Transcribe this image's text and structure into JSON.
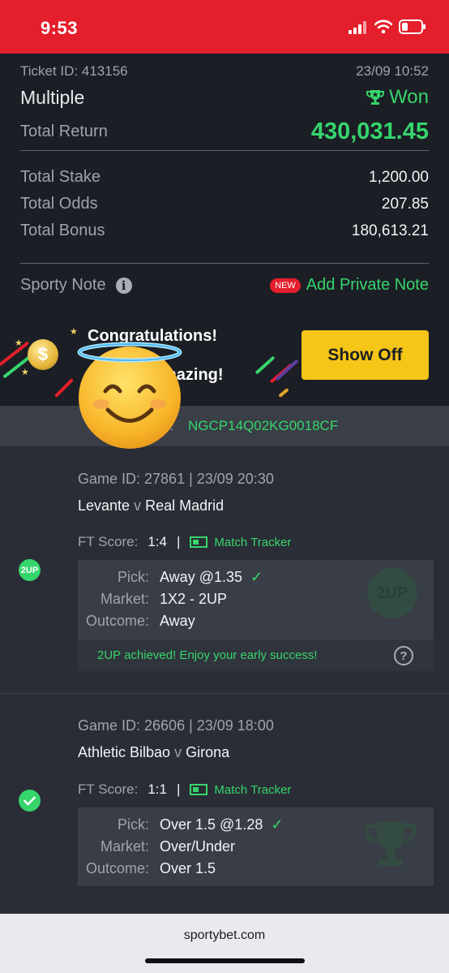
{
  "status_bar": {
    "time": "9:53"
  },
  "ticket": {
    "id_text": "Ticket ID: 413156",
    "datetime": "23/09 10:52",
    "bet_type": "Multiple",
    "status": "Won",
    "total_return_label": "Total Return",
    "total_return": "430,031.45",
    "stats": [
      {
        "label": "Total Stake",
        "value": "1,200.00"
      },
      {
        "label": "Total Odds",
        "value": "207.85"
      },
      {
        "label": "Total Bonus",
        "value": "180,613.21"
      }
    ],
    "note_label": "Sporty Note",
    "new_badge": "NEW",
    "add_note_label": "Add Private Note"
  },
  "promo": {
    "congrats_text": "Congratulations!",
    "amazing_text": "mazing!",
    "show_off_label": "Show Off",
    "coin_symbol": "$"
  },
  "booking": {
    "label_fragment": "e:",
    "code": "NGCP14Q02KG0018CF"
  },
  "games": [
    {
      "game_id_text": "Game ID: 27861 | 23/09 20:30",
      "home": "Levante",
      "vs": "v",
      "away": "Real Madrid",
      "score_label": "FT Score:",
      "score": "1:4",
      "tracker_label": "Match Tracker",
      "pick_label": "Pick:",
      "pick": "Away @1.35",
      "market_label": "Market:",
      "market": "1X2 - 2UP",
      "outcome_label": "Outcome:",
      "outcome": "Away",
      "badge": "2UP",
      "twoup_message": "2UP achieved! Enjoy your early success!"
    },
    {
      "game_id_text": "Game ID: 26606 | 23/09 18:00",
      "home": "Athletic Bilbao",
      "vs": "v",
      "away": "Girona",
      "score_label": "FT Score:",
      "score": "1:1",
      "tracker_label": "Match Tracker",
      "pick_label": "Pick:",
      "pick": "Over 1.5 @1.28",
      "market_label": "Market:",
      "market": "Over/Under",
      "outcome_label": "Outcome:",
      "outcome": "Over 1.5"
    }
  ],
  "browser": {
    "url": "sportybet.com"
  },
  "colors": {
    "brand_red": "#e41e2b",
    "win_green": "#36d56c",
    "button_yellow": "#f5c518"
  }
}
